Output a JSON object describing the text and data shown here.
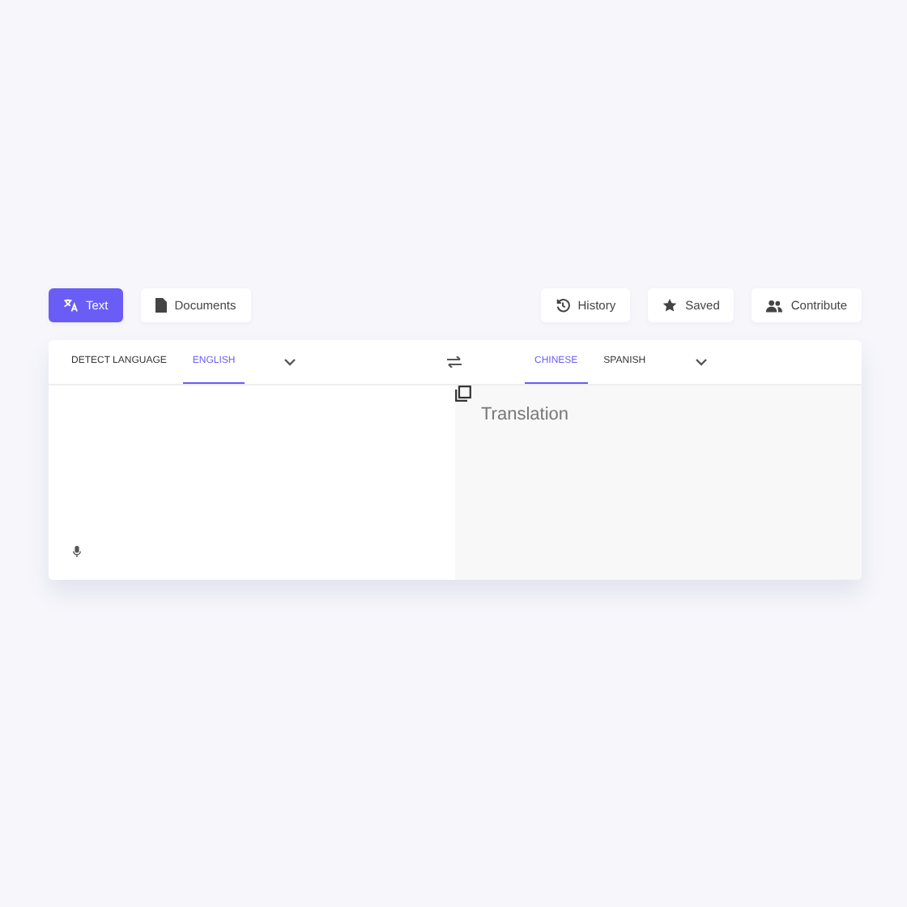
{
  "modes": [
    {
      "label": "Text",
      "selected": true
    },
    {
      "label": "Documents",
      "selected": false
    }
  ],
  "actions": [
    {
      "label": "History"
    },
    {
      "label": "Saved"
    },
    {
      "label": "Contribute"
    }
  ],
  "source": {
    "languages": [
      {
        "label": "DETECT LANGUAGE",
        "selected": false
      },
      {
        "label": "ENGLISH",
        "selected": true
      }
    ]
  },
  "target": {
    "languages": [
      {
        "label": "CHINESE",
        "selected": true
      },
      {
        "label": "SPANISH",
        "selected": false
      }
    ],
    "placeholder": "Translation"
  }
}
